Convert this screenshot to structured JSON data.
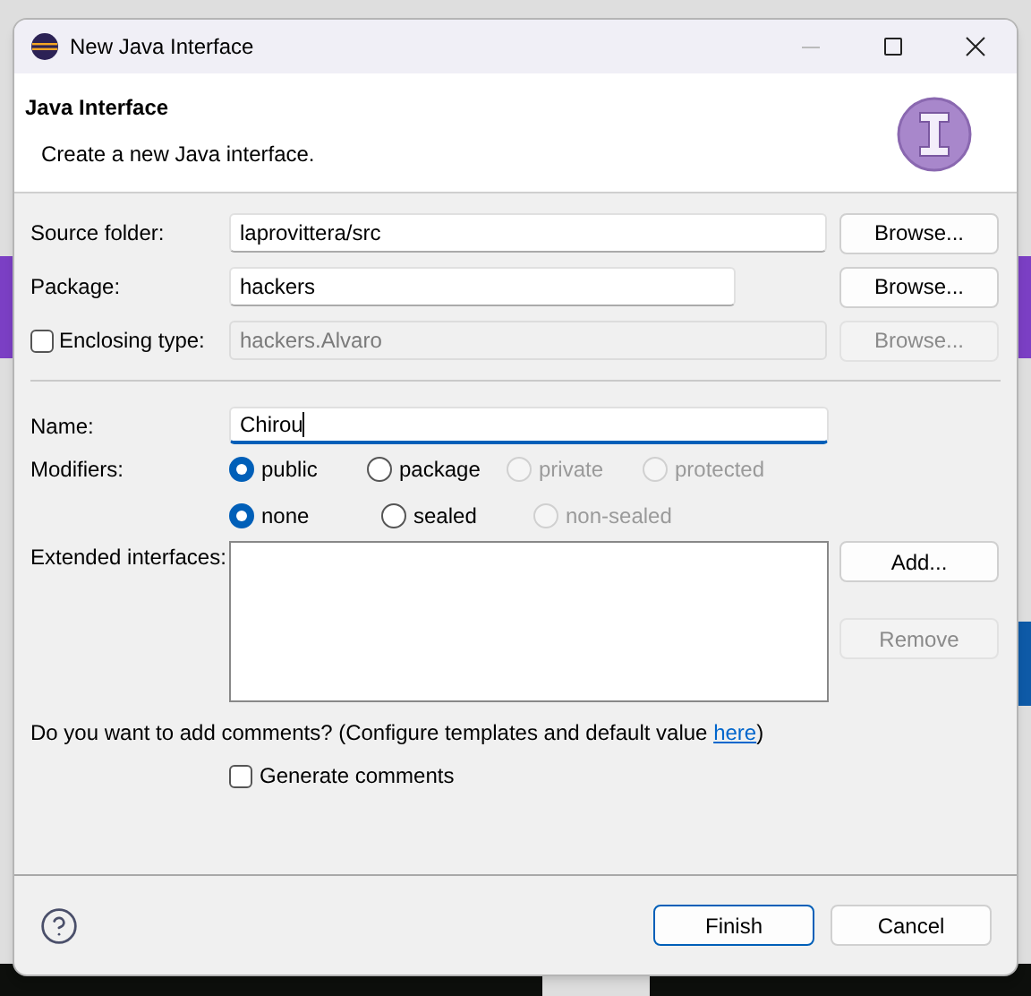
{
  "window": {
    "title": "New Java Interface"
  },
  "header": {
    "title": "Java Interface",
    "description": "Create a new Java interface."
  },
  "source_folder": {
    "label": "Source folder:",
    "value": "laprovittera/src",
    "button": {
      "label": "Browse...",
      "disabled": false
    }
  },
  "package": {
    "label": "Package:",
    "value": "hackers",
    "button": {
      "label": "Browse...",
      "disabled": false
    }
  },
  "enclosing_type": {
    "label": "Enclosing type:",
    "checked": false,
    "value": "hackers.Alvaro",
    "button": {
      "label": "Browse...",
      "disabled": true
    }
  },
  "name": {
    "label": "Name:",
    "value": "Chirou"
  },
  "modifiers": {
    "label": "Modifiers:",
    "rows": [
      [
        {
          "label": "public",
          "selected": true,
          "disabled": false
        },
        {
          "label": "package",
          "selected": false,
          "disabled": false
        },
        {
          "label": "private",
          "selected": false,
          "disabled": true
        },
        {
          "label": "protected",
          "selected": false,
          "disabled": true
        }
      ],
      [
        {
          "label": "none",
          "selected": true,
          "disabled": false
        },
        {
          "label": "sealed",
          "selected": false,
          "disabled": false
        },
        {
          "label": "non-sealed",
          "selected": false,
          "disabled": true
        }
      ]
    ]
  },
  "extended_interfaces": {
    "label": "Extended interfaces:",
    "buttons": [
      {
        "label": "Add...",
        "disabled": false
      },
      {
        "label": "Remove",
        "disabled": true
      }
    ]
  },
  "comments": {
    "text_before": "Do you want to add comments? (Configure templates and default value ",
    "link": "here",
    "text_after": ")",
    "generate": {
      "label": "Generate comments",
      "checked": false
    }
  },
  "footer_buttons": [
    {
      "label": "Finish",
      "default": true
    },
    {
      "label": "Cancel",
      "default": false
    }
  ]
}
